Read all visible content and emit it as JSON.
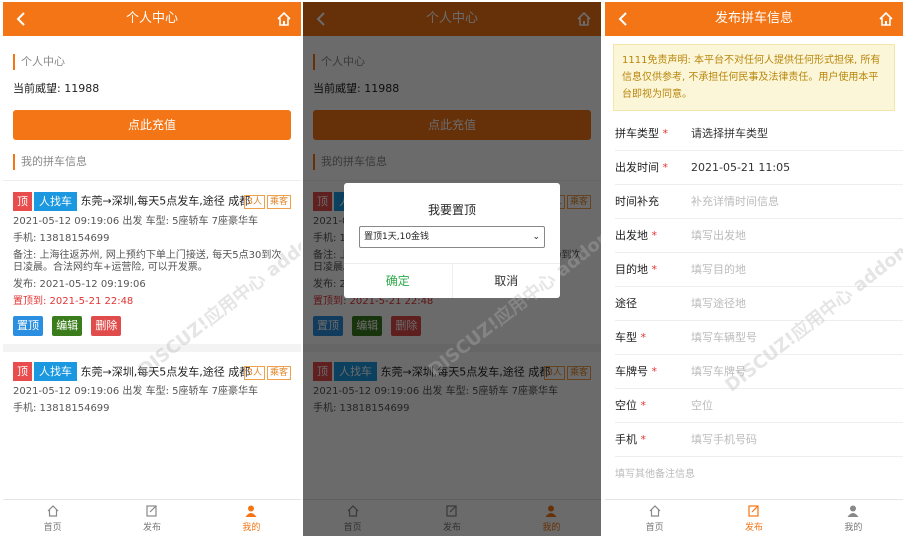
{
  "screen1": {
    "header": {
      "title": "个人中心"
    },
    "section_title": "个人中心",
    "points": "当前威望: 11988",
    "recharge_label": "点此充值",
    "my_carpool_title": "我的拼车信息",
    "cards": [
      {
        "tag_top": "顶",
        "tag_type": "人找车",
        "route": "东莞→深圳,每天5点发车,途径 成都",
        "badge_seats": "3人",
        "badge_kind": "乘客",
        "time_line": "2021-05-12 09:19:06 出发  车型: 5座轿车 7座豪华车",
        "phone_line": "手机: 13818154699",
        "remark_line": "备注: 上海往返苏州, 网上预约下单上门接送, 每天5点30到次日凌晨。合法网约车+运营险, 可以开发票。",
        "publish_line": "发布: 2021-05-12 09:19:06",
        "top_until": "置顶到: 2021-5-21 22:48",
        "btn_top": "置顶",
        "btn_edit": "编辑",
        "btn_delete": "删除"
      },
      {
        "tag_top": "顶",
        "tag_type": "人找车",
        "route": "东莞→深圳,每天5点发车,途径 成都",
        "badge_seats": "3人",
        "badge_kind": "乘客",
        "time_line": "2021-05-12 09:19:06 出发  车型: 5座轿车 7座豪华车",
        "phone_line": "手机: 13818154699"
      }
    ],
    "tabs": [
      {
        "label": "首页",
        "icon": "home-icon"
      },
      {
        "label": "发布",
        "icon": "edit-icon"
      },
      {
        "label": "我的",
        "icon": "user-icon"
      }
    ]
  },
  "screen2": {
    "dialog": {
      "title": "我要置顶",
      "select_value": "置顶1天,10金钱",
      "confirm": "确定",
      "cancel": "取消"
    }
  },
  "screen3": {
    "header": {
      "title": "发布拼车信息"
    },
    "notice": "1111免责声明: 本平台不对任何人提供任何形式担保, 所有信息仅供参考, 不承担任何民事及法律责任。用户使用本平台即视为同意。",
    "fields": [
      {
        "label": "拼车类型",
        "required": true,
        "value": "请选择拼车类型",
        "placeholder": ""
      },
      {
        "label": "出发时间",
        "required": true,
        "value": "2021-05-21 11:05",
        "placeholder": ""
      },
      {
        "label": "时间补充",
        "required": false,
        "value": "",
        "placeholder": "补充详情时间信息"
      },
      {
        "label": "出发地",
        "required": true,
        "value": "",
        "placeholder": "填写出发地"
      },
      {
        "label": "目的地",
        "required": true,
        "value": "",
        "placeholder": "填写目的地"
      },
      {
        "label": "途径",
        "required": false,
        "value": "",
        "placeholder": "填写途径地"
      },
      {
        "label": "车型",
        "required": true,
        "value": "",
        "placeholder": "填写车辆型号"
      },
      {
        "label": "车牌号",
        "required": true,
        "value": "",
        "placeholder": "填写车牌号"
      },
      {
        "label": "空位",
        "required": true,
        "value": "",
        "placeholder": "空位"
      },
      {
        "label": "手机",
        "required": true,
        "value": "",
        "placeholder": "填写手机号码"
      }
    ],
    "remark_placeholder": "填写其他备注信息",
    "active_tab": "发布"
  },
  "watermark": "DISCUZ!应用中心 addon.dismall.com 贰道",
  "colors": {
    "accent": "#f47515",
    "overlay": "rgba(0,0,0,0.58)"
  }
}
